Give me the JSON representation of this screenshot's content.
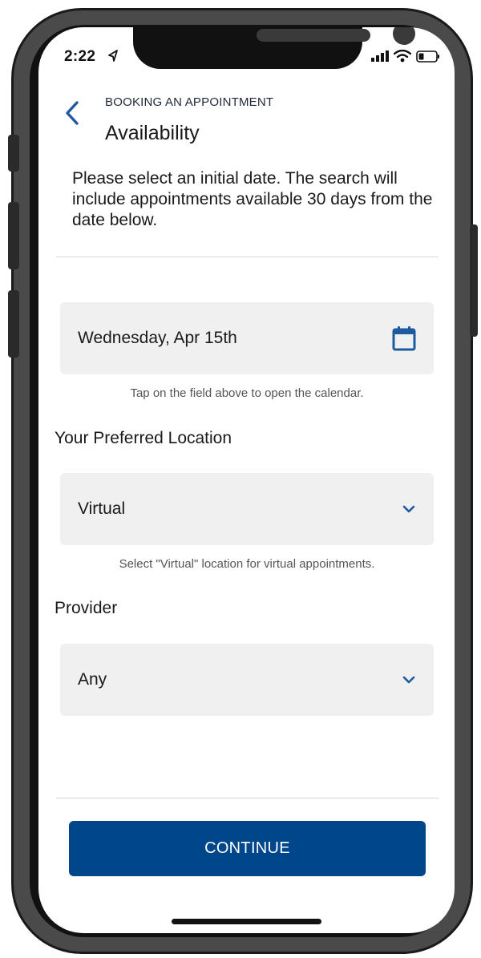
{
  "status_bar": {
    "time": "2:22"
  },
  "header": {
    "eyebrow": "BOOKING AN APPOINTMENT",
    "title": "Availability"
  },
  "intro": "Please select an initial date. The search will include appointments available 30 days from the date below.",
  "date_field": {
    "value": "Wednesday, Apr 15th",
    "helper": "Tap on the field above to open the calendar."
  },
  "location": {
    "label": "Your Preferred Location",
    "value": "Virtual",
    "helper": "Select \"Virtual\" location for virtual appointments."
  },
  "provider": {
    "label": "Provider",
    "value": "Any"
  },
  "continue_label": "CONTINUE",
  "colors": {
    "accent": "#00468b",
    "field_bg": "#f0f0f0",
    "icon_blue": "#1e5aa0"
  }
}
